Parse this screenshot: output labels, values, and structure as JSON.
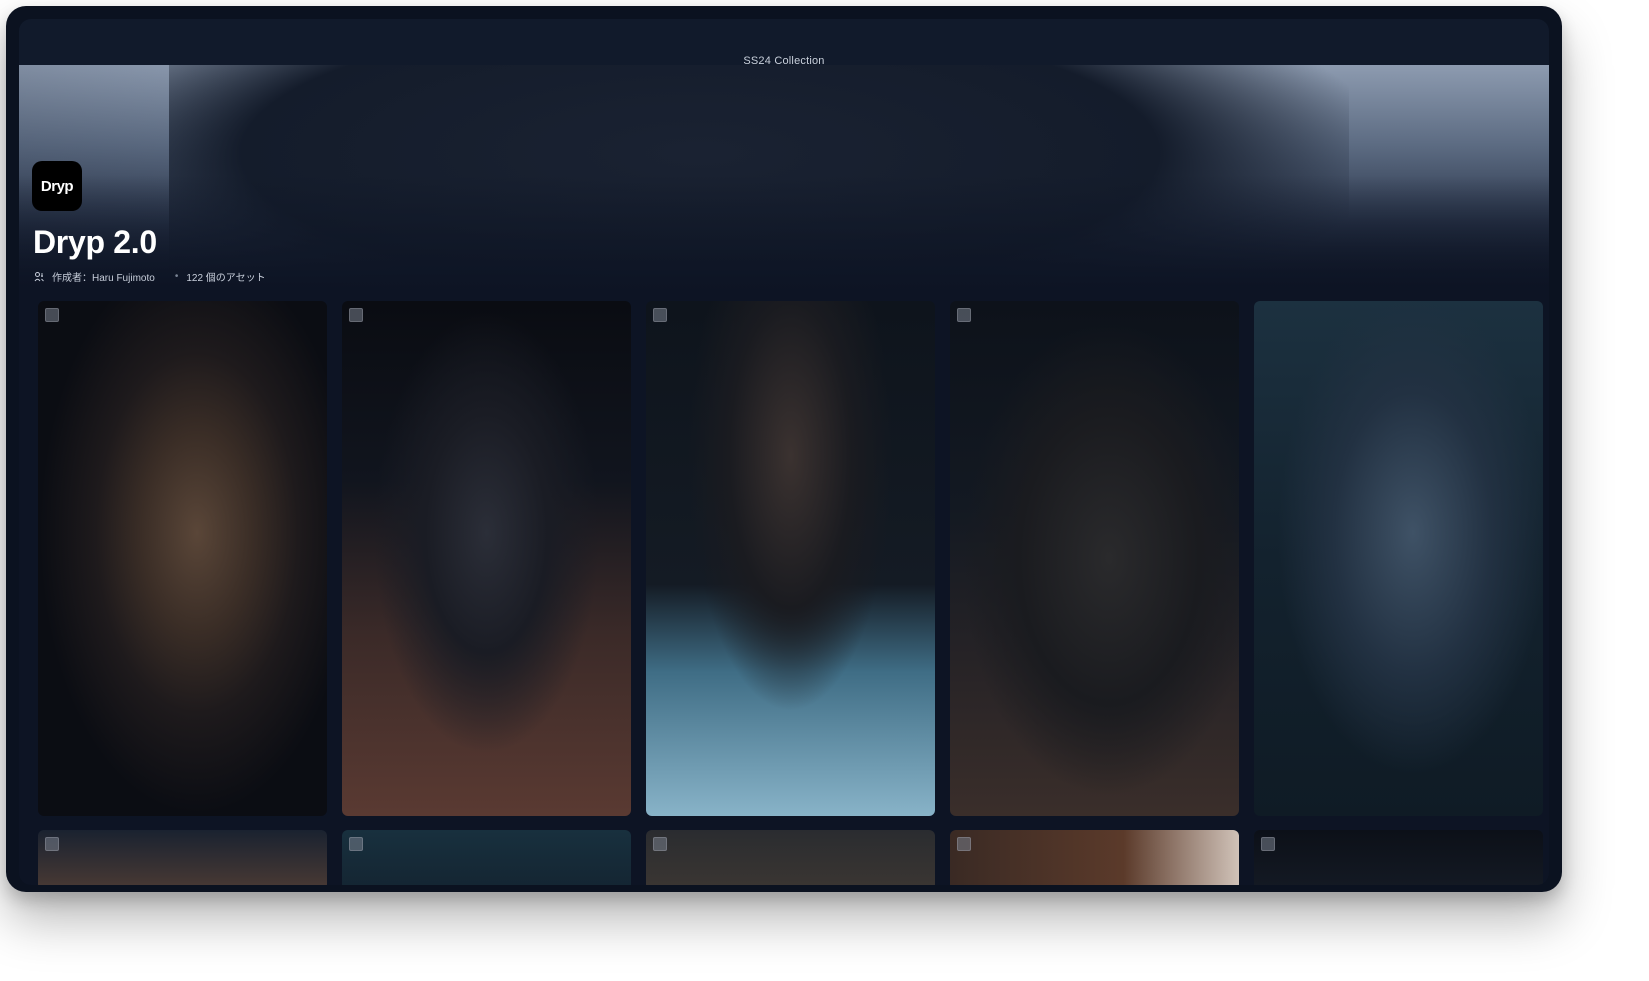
{
  "window": {
    "title": "SS24 Collection"
  },
  "project": {
    "logo_text": "Dryp",
    "title": "Dryp 2.0",
    "creator": "作成者：Haru Fujimoto",
    "asset_count": "122 個のアセット"
  },
  "assets": [
    {
      "name": "asset-sweat-closeup",
      "checked": false
    },
    {
      "name": "asset-track-runner",
      "checked": false
    },
    {
      "name": "asset-ice-bath",
      "checked": false
    },
    {
      "name": "asset-bottle-drink",
      "checked": false
    },
    {
      "name": "asset-treadmill-mask",
      "checked": false
    },
    {
      "name": "asset-row2-1",
      "checked": false
    },
    {
      "name": "asset-row2-2",
      "checked": false
    },
    {
      "name": "asset-row2-3",
      "checked": false
    },
    {
      "name": "asset-row2-4",
      "checked": false
    },
    {
      "name": "asset-row2-5",
      "checked": false
    }
  ]
}
